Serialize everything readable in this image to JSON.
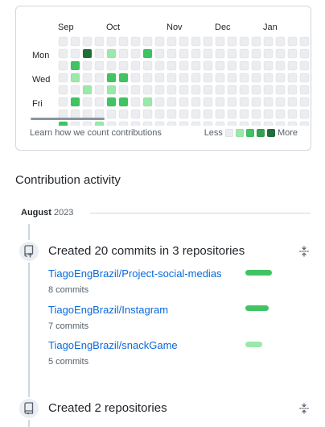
{
  "graph": {
    "months": [
      "Sep",
      "Oct",
      "Nov",
      "Dec",
      "Jan"
    ],
    "day_labels": [
      "Mon",
      "Wed",
      "Fri"
    ],
    "learn_text": "Learn how we count contributions",
    "legend_less": "Less",
    "legend_more": "More",
    "colors": {
      "L0": "#ebedf0",
      "L1": "#9be9a8",
      "L2": "#40c463",
      "L3": "#30a14e",
      "L4": "#216e39"
    },
    "levels": [
      [
        0,
        0,
        0,
        0,
        0,
        0,
        0,
        0,
        0,
        0,
        0,
        0,
        0,
        0,
        0,
        0,
        0,
        0,
        0,
        0,
        0,
        0
      ],
      [
        0,
        0,
        4,
        0,
        1,
        0,
        0,
        2,
        0,
        0,
        0,
        0,
        0,
        0,
        0,
        0,
        0,
        0,
        0,
        0,
        0,
        0
      ],
      [
        0,
        2,
        0,
        0,
        0,
        0,
        0,
        0,
        0,
        0,
        0,
        0,
        0,
        0,
        0,
        0,
        0,
        0,
        0,
        0,
        0,
        0
      ],
      [
        0,
        1,
        0,
        0,
        2,
        2,
        0,
        0,
        0,
        0,
        0,
        0,
        0,
        0,
        0,
        0,
        0,
        0,
        0,
        0,
        0,
        0
      ],
      [
        0,
        0,
        1,
        0,
        1,
        0,
        0,
        0,
        0,
        0,
        0,
        0,
        0,
        0,
        0,
        0,
        0,
        0,
        0,
        0,
        0,
        0
      ],
      [
        0,
        2,
        0,
        0,
        2,
        2,
        0,
        1,
        0,
        0,
        0,
        0,
        0,
        0,
        0,
        0,
        0,
        0,
        0,
        0,
        0,
        0
      ],
      [
        0,
        0,
        0,
        0,
        0,
        0,
        0,
        0,
        0,
        0,
        0,
        0,
        0,
        0,
        0,
        0,
        0,
        0,
        0,
        0,
        0,
        0
      ],
      [
        2,
        0,
        0,
        1,
        0,
        0,
        0,
        0,
        0,
        0,
        0,
        0,
        0,
        0,
        0,
        0,
        0,
        0,
        0,
        0,
        0,
        0
      ]
    ]
  },
  "activity": {
    "title": "Contribution activity",
    "month": "August",
    "year": "2023",
    "commits": {
      "title": "Created 20 commits in 3 repositories",
      "icon": "repo-push-icon",
      "repos": [
        {
          "name": "TiagoEngBrazil/Project-social-medias",
          "count": "8 commits",
          "share": 1.0,
          "color": "#40c463"
        },
        {
          "name": "TiagoEngBrazil/Instagram",
          "count": "7 commits",
          "share": 0.88,
          "color": "#40c463"
        },
        {
          "name": "TiagoEngBrazil/snackGame",
          "count": "5 commits",
          "share": 0.65,
          "color": "#9be9a8"
        }
      ]
    },
    "repos_created": {
      "title": "Created 2 repositories",
      "icon": "repo-icon"
    }
  }
}
